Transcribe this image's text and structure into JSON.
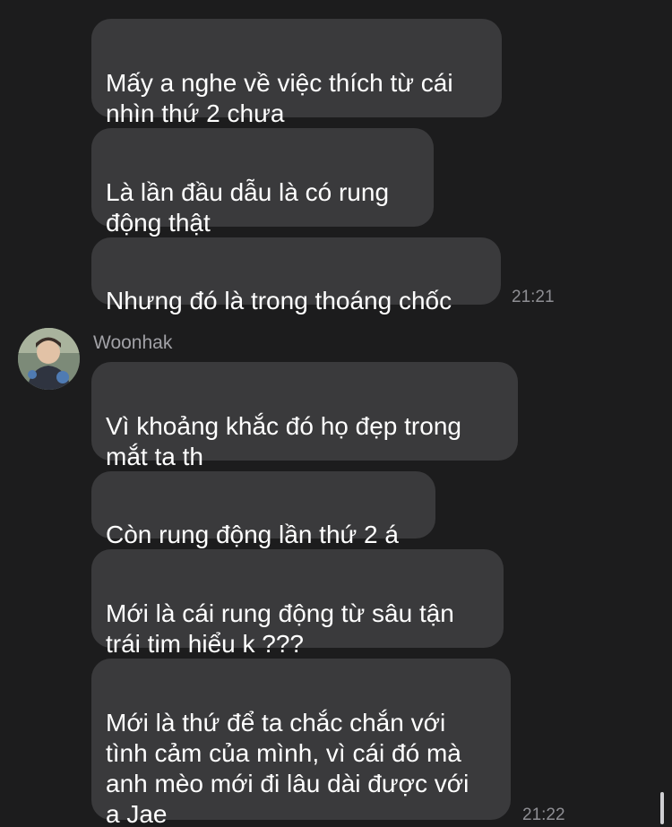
{
  "messages_top": [
    {
      "text": "Mấy a nghe về việc thích từ cái\nnhìn thứ 2 chưa"
    },
    {
      "text": "Là lần đầu dẫu là có rung\nđộng thật"
    },
    {
      "text": "Nhưng đó là trong thoáng chốc"
    }
  ],
  "time_1": "21:21",
  "sender": {
    "name": "Woonhak",
    "avatar_icon": "profile-photo"
  },
  "messages_woonhak": [
    {
      "text": "Vì khoảng khắc đó họ đẹp trong\nmắt ta th"
    },
    {
      "text": "Còn rung động lần thứ 2 á"
    },
    {
      "text": "Mới là cái rung động từ sâu tận\ntrái tim hiểu k ???"
    },
    {
      "text": "Mới là thứ để ta chắc chắn với\ntình cảm của mình, vì cái đó mà\nanh mèo mới đi lâu dài được với\na Jae"
    }
  ],
  "time_2": "21:22",
  "colors": {
    "background": "#1c1c1d",
    "bubble": "#3a3a3c",
    "text": "#ffffff",
    "timestamp": "#8e8e93"
  }
}
